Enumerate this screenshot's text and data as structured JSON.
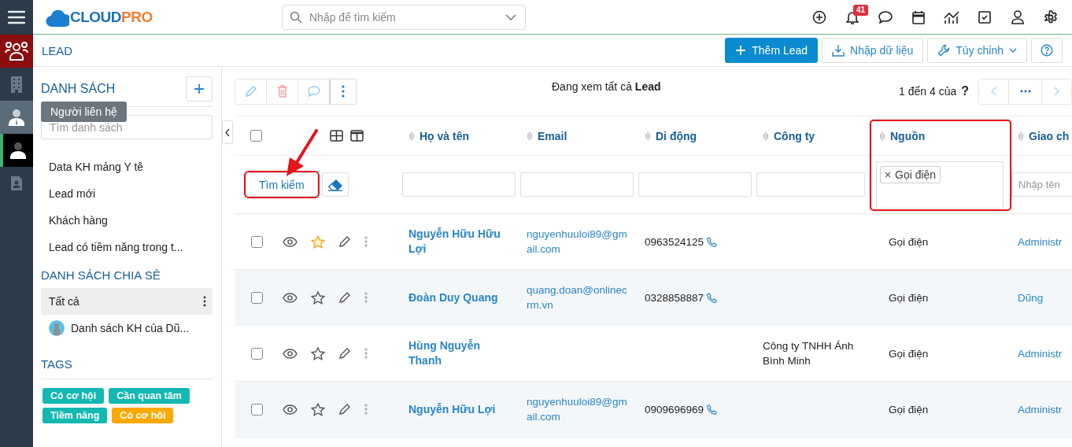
{
  "header": {
    "logo": {
      "main": "CLOUD",
      "accent": "PRO"
    },
    "search": {
      "placeholder": "Nhập để tìm kiếm"
    },
    "icons": [
      {
        "kind": "add"
      },
      {
        "kind": "bell",
        "badge": "41"
      },
      {
        "kind": "chat"
      },
      {
        "kind": "calendar"
      },
      {
        "kind": "report"
      },
      {
        "kind": "task"
      },
      {
        "kind": "user"
      },
      {
        "kind": "settings"
      }
    ]
  },
  "rail": {
    "items": [
      {
        "kind": "people",
        "selected": true,
        "hovered": false,
        "highlighted": false
      },
      {
        "kind": "building",
        "selected": false,
        "hovered": false,
        "highlighted": false
      },
      {
        "kind": "contact",
        "selected": false,
        "hovered": true,
        "highlighted": false
      },
      {
        "kind": "person",
        "selected": false,
        "hovered": false,
        "highlighted": true
      },
      {
        "kind": "document",
        "selected": false,
        "hovered": false,
        "highlighted": false
      }
    ],
    "tooltip": "Người liên hệ"
  },
  "module": {
    "title": "LEAD",
    "buttons": [
      {
        "kind": "add",
        "label": "Thêm Lead"
      },
      {
        "kind": "import",
        "label": "Nhập dữ liệu"
      },
      {
        "kind": "customize",
        "label": "Tùy chỉnh"
      },
      {
        "kind": "help"
      }
    ]
  },
  "sidebar": {
    "title": "DANH SÁCH",
    "search": {
      "placeholder": "Tìm danh sách"
    },
    "lists": [
      {
        "label": "Data KH mảng Y tê",
        "selected": false
      },
      {
        "label": "Lead mới",
        "selected": false
      },
      {
        "label": "Khách hàng",
        "selected": false
      },
      {
        "label": "Lead có tiềm năng trong t...",
        "selected": false
      }
    ],
    "shared_title": "DANH SÁCH CHIA SẺ",
    "shared": [
      {
        "label": "Tất cả",
        "selected": true,
        "avatar": false
      },
      {
        "label": "Danh sách KH của Dũ...",
        "selected": false,
        "avatar": true
      }
    ],
    "tags_title": "TAGS",
    "tags": [
      {
        "label": "Có cơ hội",
        "color": "#13b8b0"
      },
      {
        "label": "Cần quan tâm",
        "color": "#13b8b0"
      },
      {
        "label": "Tiềm năng",
        "color": "#13b8b0"
      },
      {
        "label": "Có cơ hôi",
        "color": "#ffa800"
      }
    ]
  },
  "toolbar": {
    "actions": [
      {
        "kind": "edit"
      },
      {
        "kind": "delete"
      },
      {
        "kind": "comment"
      },
      {
        "kind": "more"
      }
    ],
    "caption": "Đang xem tất cả **Lead**",
    "pager": {
      "range": "1 đến 4 của",
      "total": "?"
    }
  },
  "table": {
    "all_checked": false,
    "columns": [
      {
        "label": "Họ và tên",
        "highlighted": false
      },
      {
        "label": "Email",
        "highlighted": false
      },
      {
        "label": "Di động",
        "highlighted": false
      },
      {
        "label": "Công ty",
        "highlighted": false
      },
      {
        "label": "Nguồn",
        "highlighted": true
      },
      {
        "label": "Giao ch",
        "highlighted": false
      }
    ],
    "search_button": {
      "label": "Tìm kiếm",
      "highlighted": true
    },
    "filters": [
      {
        "kind": "text"
      },
      {
        "kind": "text"
      },
      {
        "kind": "text"
      },
      {
        "kind": "text"
      },
      {
        "kind": "tags",
        "tags": [
          "Gọi điện"
        ]
      },
      {
        "kind": "text",
        "placeholder": "Nhập tên"
      }
    ],
    "rows": [
      {
        "checked": false,
        "starred": true,
        "name": "Nguyễn Hữu Hữu Lợi",
        "email": "nguyenhuuloi89@gmail.com",
        "phone": "0963524125",
        "source": "Gọi điện",
        "assignee": "Administr"
      },
      {
        "checked": false,
        "starred": false,
        "name": "Đoàn Duy Quang",
        "email": "quang.doan@onlinecrm.vn",
        "phone": "0328858887",
        "source": "Gọi điện",
        "assignee": "Dũng"
      },
      {
        "checked": false,
        "starred": false,
        "name": "Hùng Nguyễn Thanh",
        "company": "Công ty TNHH Ánh Bình Minh",
        "source": "Gọi điện",
        "assignee": "Administr"
      },
      {
        "checked": false,
        "starred": false,
        "name": "Nguyễn Hữu Lợi",
        "email": "nguyenhuuloi89@gmail.com",
        "phone": "0909696969",
        "source": "Gọi điện",
        "assignee": "Administr"
      }
    ]
  }
}
